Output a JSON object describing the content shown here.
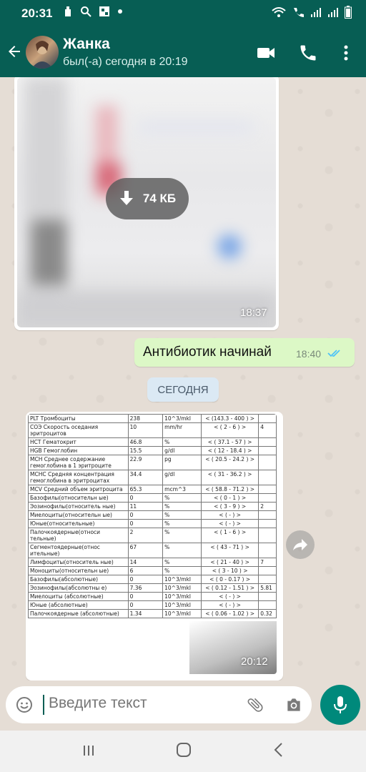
{
  "status_bar": {
    "time": "20:31"
  },
  "header": {
    "contact_name": "Жанка",
    "last_seen": "был(-а) сегодня в 20:19"
  },
  "messages": {
    "image1": {
      "download_size": "74 КБ",
      "time": "18:37"
    },
    "outgoing": {
      "text": "Антибиотик начинай",
      "time": "18:40",
      "status": "read"
    },
    "date_separator": "СЕГОДНЯ",
    "image2": {
      "time": "20:12",
      "table_rows": [
        [
          "PLT Тромбоциты",
          "238",
          "10^3/mkl",
          "< (143.3 - 400 ) >",
          ""
        ],
        [
          "СОЭ Скорость оседания эритроцитов",
          "10",
          "mm/hr",
          "< ( 2 - 6 ) >",
          "4"
        ],
        [
          "HCT Гематокрит",
          "46.8",
          "%",
          "< ( 37.1 - 57 ) >",
          ""
        ],
        [
          "HGB Гемоглобин",
          "15.5",
          "g/dl",
          "< ( 12 - 18.4 ) >",
          ""
        ],
        [
          "MCH Среднее содержание гемоглобина в 1 эритроците",
          "22.9",
          "pg",
          "< ( 20.5 - 24.2 ) >",
          ""
        ],
        [
          "MCHC Средняя концентрация гемоглобина в эритроцитах",
          "34.4",
          "g/dl",
          "< ( 31 - 36.2 ) >",
          ""
        ],
        [
          "MCV Средний объем эритроцита",
          "65.3",
          "mcm^3",
          "< ( 58.8 - 71.2 ) >",
          ""
        ],
        [
          "Базофилы(относительн ые)",
          "0",
          "%",
          "< ( 0 - 1 ) >",
          ""
        ],
        [
          "Эозинофилы(относитель ные)",
          "11",
          "%",
          "< ( 3 - 9 ) >",
          "2"
        ],
        [
          "Миелоциты(относительн ые)",
          "0",
          "%",
          "< ( - ) >",
          ""
        ],
        [
          "Юные(относительные)",
          "0",
          "%",
          "< ( - ) >",
          ""
        ],
        [
          "Палочкоядерные(относи тельные)",
          "2",
          "%",
          "< ( 1 - 6 ) >",
          ""
        ],
        [
          "Сегментоядерные(относ ительные)",
          "67",
          "%",
          "< ( 43 - 71 ) >",
          ""
        ],
        [
          "Лимфоциты(относитель ные)",
          "14",
          "%",
          "< ( 21 - 40 ) >",
          "7"
        ],
        [
          "Моноциты(относительн ые)",
          "6",
          "%",
          "< ( 3 - 10 ) >",
          ""
        ],
        [
          "Базофилы(абсолютные)",
          "0",
          "10^3/mkl",
          "< ( 0 - 0.17 ) >",
          ""
        ],
        [
          "Эозинофилы(абсолютны е)",
          "7.36",
          "10^3/mkl",
          "< ( 0.12 - 1.51 ) >",
          "5.81"
        ],
        [
          "Миелоциты (абсолютные)",
          "0",
          "10^3/mkl",
          "< ( - ) >",
          ""
        ],
        [
          "Юные (абсолютные)",
          "0",
          "10^3/mkl",
          "< ( - ) >",
          ""
        ],
        [
          "Палочкоядерные (абсолютные)",
          "1.34",
          "10^3/mkl",
          "< ( 0.06 - 1.02 ) >",
          "0.32"
        ]
      ]
    }
  },
  "input": {
    "placeholder": "Введите текст"
  },
  "colors": {
    "header": "#075e54",
    "outgoing_bubble": "#dcf8c6",
    "mic_button": "#00897b",
    "read_ticks": "#4fc3f7"
  }
}
